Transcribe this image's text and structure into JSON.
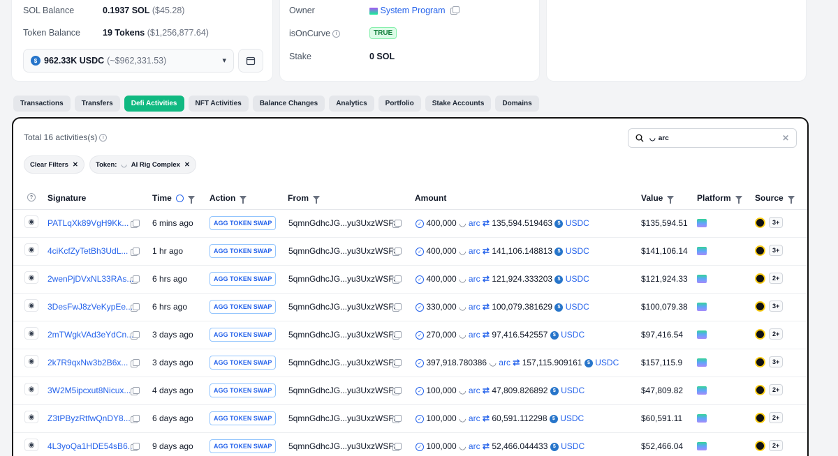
{
  "balance_card": {
    "sol_label": "SOL Balance",
    "sol_value": "0.1937 SOL",
    "sol_usd": "($45.28)",
    "token_label": "Token Balance",
    "token_value": "19 Tokens",
    "token_usd": "($1,256,877.64)",
    "selected_token_amount": "962.33K USDC",
    "selected_token_usd": "(~$962,331.53)"
  },
  "owner_card": {
    "owner_label": "Owner",
    "owner_value": "System Program",
    "oncurve_label": "isOnCurve",
    "oncurve_value": "TRUE",
    "stake_label": "Stake",
    "stake_value": "0 SOL"
  },
  "tabs": [
    "Transactions",
    "Transfers",
    "Defi Activities",
    "NFT Activities",
    "Balance Changes",
    "Analytics",
    "Portfolio",
    "Stake Accounts",
    "Domains"
  ],
  "active_tab": "Defi Activities",
  "panel": {
    "total": "Total 16 activities(s)",
    "search_value": "arc",
    "clear_filters": "Clear Filters",
    "token_filter_label": "Token:",
    "token_filter_value": "AI Rig Complex"
  },
  "columns": {
    "signature": "Signature",
    "time": "Time",
    "action": "Action",
    "from": "From",
    "amount": "Amount",
    "value": "Value",
    "platform": "Platform",
    "source": "Source"
  },
  "rows": [
    {
      "sig": "PATLqXk89VgH9Kk...",
      "time": "6 mins ago",
      "action": "AGG TOKEN SWAP",
      "from": "5qmnGdhcJG...yu3UxzWSFJ",
      "in_amt": "400,000",
      "in_tok": "arc",
      "out_amt": "135,594.519463",
      "out_tok": "USDC",
      "value": "$135,594.51",
      "src_count": "3+"
    },
    {
      "sig": "4ciKcfZyTetBh3UdL...",
      "time": "1 hr ago",
      "action": "AGG TOKEN SWAP",
      "from": "5qmnGdhcJG...yu3UxzWSFJ",
      "in_amt": "400,000",
      "in_tok": "arc",
      "out_amt": "141,106.148813",
      "out_tok": "USDC",
      "value": "$141,106.14",
      "src_count": "3+"
    },
    {
      "sig": "2wenPjDVxNL33RAs...",
      "time": "6 hrs ago",
      "action": "AGG TOKEN SWAP",
      "from": "5qmnGdhcJG...yu3UxzWSFJ",
      "in_amt": "400,000",
      "in_tok": "arc",
      "out_amt": "121,924.333203",
      "out_tok": "USDC",
      "value": "$121,924.33",
      "src_count": "2+"
    },
    {
      "sig": "3DesFwJ8zVeKypEe...",
      "time": "6 hrs ago",
      "action": "AGG TOKEN SWAP",
      "from": "5qmnGdhcJG...yu3UxzWSFJ",
      "in_amt": "330,000",
      "in_tok": "arc",
      "out_amt": "100,079.381629",
      "out_tok": "USDC",
      "value": "$100,079.38",
      "src_count": "3+"
    },
    {
      "sig": "2mTWgkVAd3eYdCn...",
      "time": "3 days ago",
      "action": "AGG TOKEN SWAP",
      "from": "5qmnGdhcJG...yu3UxzWSFJ",
      "in_amt": "270,000",
      "in_tok": "arc",
      "out_amt": "97,416.542557",
      "out_tok": "USDC",
      "value": "$97,416.54",
      "src_count": "2+"
    },
    {
      "sig": "2k7R9qxNw3b2B6x...",
      "time": "3 days ago",
      "action": "AGG TOKEN SWAP",
      "from": "5qmnGdhcJG...yu3UxzWSFJ",
      "in_amt": "397,918.780386",
      "in_tok": "arc",
      "out_amt": "157,115.909161",
      "out_tok": "USDC",
      "value": "$157,115.9",
      "src_count": "3+"
    },
    {
      "sig": "3W2M5ipcxut8Nicux...",
      "time": "4 days ago",
      "action": "AGG TOKEN SWAP",
      "from": "5qmnGdhcJG...yu3UxzWSFJ",
      "in_amt": "100,000",
      "in_tok": "arc",
      "out_amt": "47,809.826892",
      "out_tok": "USDC",
      "value": "$47,809.82",
      "src_count": "2+"
    },
    {
      "sig": "Z3tPByzRtfwQnDY8...",
      "time": "6 days ago",
      "action": "AGG TOKEN SWAP",
      "from": "5qmnGdhcJG...yu3UxzWSFJ",
      "in_amt": "100,000",
      "in_tok": "arc",
      "out_amt": "60,591.112298",
      "out_tok": "USDC",
      "value": "$60,591.11",
      "src_count": "2+"
    },
    {
      "sig": "4L3yoQa1HDE54sB6...",
      "time": "9 days ago",
      "action": "AGG TOKEN SWAP",
      "from": "5qmnGdhcJG...yu3UxzWSFJ",
      "in_amt": "100,000",
      "in_tok": "arc",
      "out_amt": "52,466.044433",
      "out_tok": "USDC",
      "value": "$52,466.04",
      "src_count": "2+"
    }
  ]
}
